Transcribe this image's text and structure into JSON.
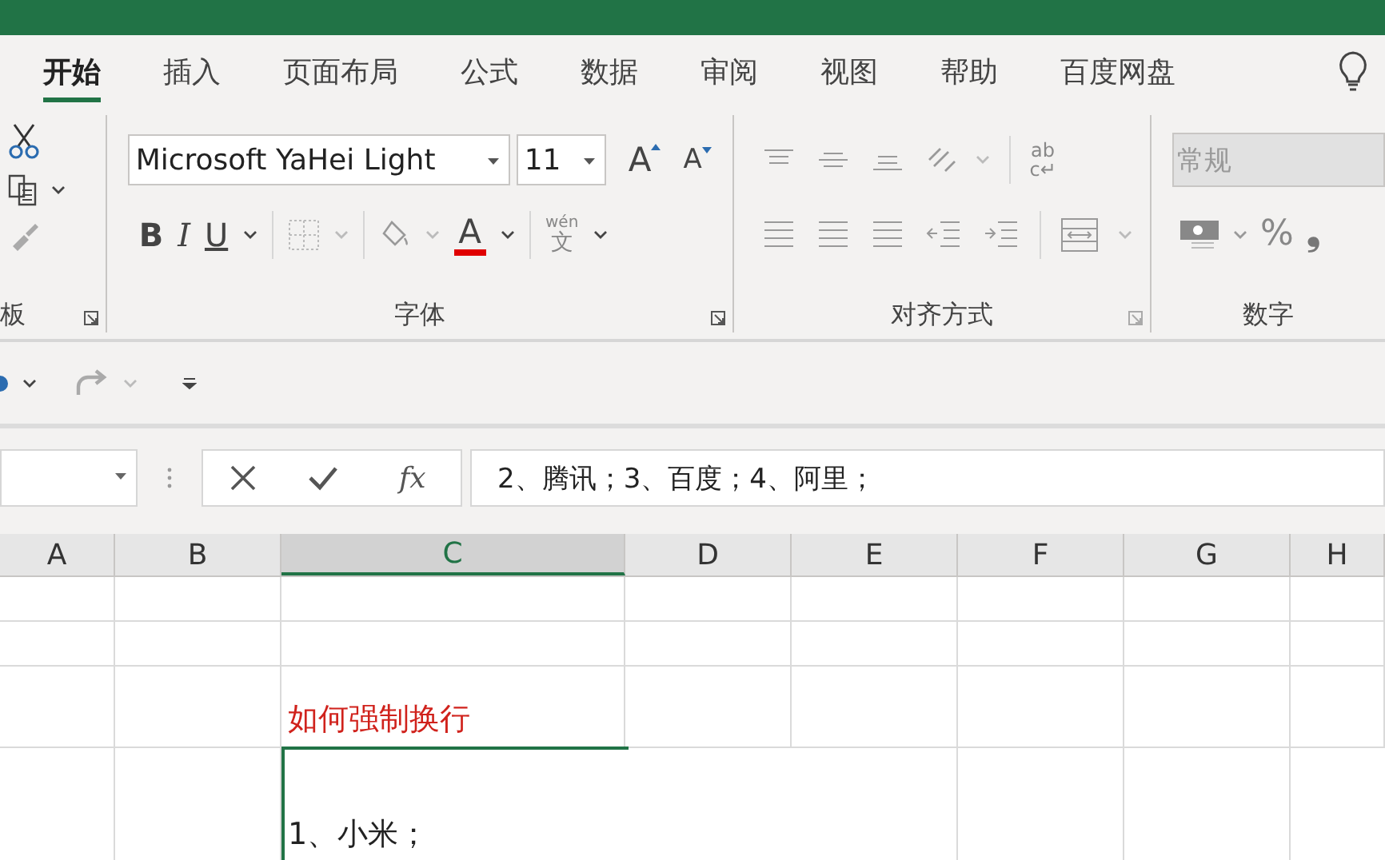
{
  "tabs": [
    {
      "label": "开始",
      "selected": true
    },
    {
      "label": "插入",
      "selected": false
    },
    {
      "label": "页面布局",
      "selected": false
    },
    {
      "label": "公式",
      "selected": false
    },
    {
      "label": "数据",
      "selected": false
    },
    {
      "label": "审阅",
      "selected": false
    },
    {
      "label": "视图",
      "selected": false
    },
    {
      "label": "帮助",
      "selected": false
    },
    {
      "label": "百度网盘",
      "selected": false
    }
  ],
  "ribbon": {
    "clipboard": {
      "label": "板"
    },
    "font": {
      "font_name": "Microsoft YaHei Light",
      "font_size": "11",
      "grow_glyph": "A",
      "shrink_glyph": "A",
      "style_buttons": [
        "B",
        "I",
        "U"
      ],
      "font_color_glyph": "A",
      "phonetic_top": "wén",
      "phonetic_glyph": "文",
      "label": "字体"
    },
    "alignment": {
      "wrap_top": "ab",
      "wrap_bottom": "c↵",
      "label": "对齐方式"
    },
    "number": {
      "format": "常规",
      "percent_glyph": "%",
      "comma_glyph": "❟",
      "label": "数字"
    }
  },
  "formula_bar": {
    "function_glyph": "fx",
    "formula": "2、腾讯；3、百度；4、阿里；"
  },
  "columns": [
    {
      "label": "A",
      "selected": false
    },
    {
      "label": "B",
      "selected": false
    },
    {
      "label": "C",
      "selected": true
    },
    {
      "label": "D",
      "selected": false
    },
    {
      "label": "E",
      "selected": false
    },
    {
      "label": "F",
      "selected": false
    },
    {
      "label": "G",
      "selected": false
    },
    {
      "label": "H",
      "selected": false
    }
  ],
  "cells": [
    {
      "text": "如何强制换行",
      "color": "#d0221c",
      "merged": false,
      "selected": false
    },
    {
      "text": "1、小米；",
      "color": "#222222",
      "merged": true,
      "selected": true
    }
  ]
}
